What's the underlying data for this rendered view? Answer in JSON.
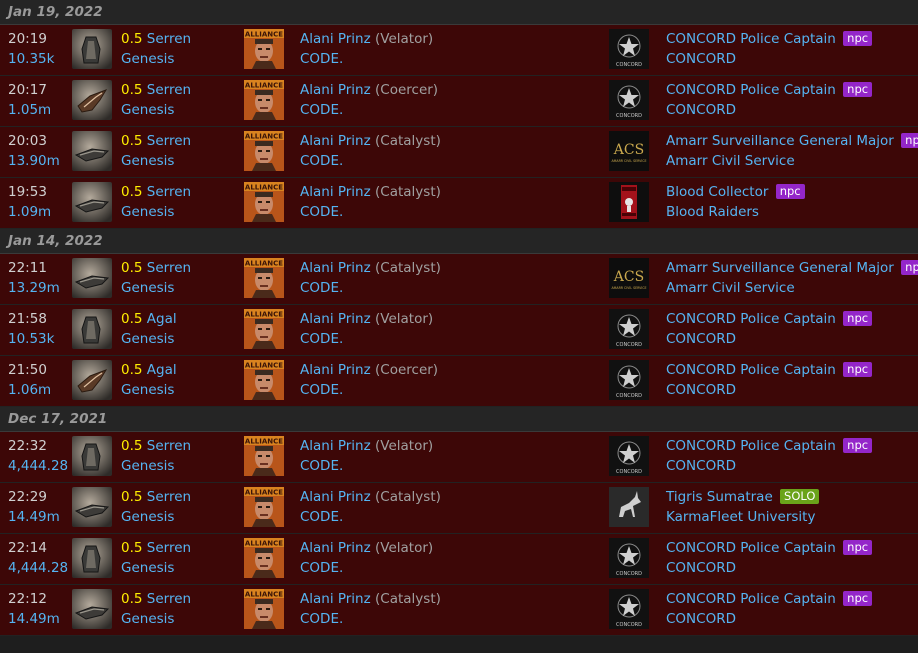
{
  "groups": [
    {
      "date": "Jan 19, 2022",
      "kills": [
        {
          "time": "20:19",
          "value": "10.35k",
          "ship_icon": "velator-icon",
          "sec": "0.5",
          "system": "Serren",
          "region": "Genesis",
          "pilot": "Alani Prinz",
          "ship": "(Velator)",
          "corp": "CODE.",
          "attacker_icon": "concord-logo",
          "attacker": "CONCORD Police Captain",
          "attacker_corp": "CONCORD",
          "badge": "npc"
        },
        {
          "time": "20:17",
          "value": "1.05m",
          "ship_icon": "coercer-icon",
          "sec": "0.5",
          "system": "Serren",
          "region": "Genesis",
          "pilot": "Alani Prinz",
          "ship": "(Coercer)",
          "corp": "CODE.",
          "attacker_icon": "concord-logo",
          "attacker": "CONCORD Police Captain",
          "attacker_corp": "CONCORD",
          "badge": "npc"
        },
        {
          "time": "20:03",
          "value": "13.90m",
          "ship_icon": "catalyst-icon",
          "sec": "0.5",
          "system": "Serren",
          "region": "Genesis",
          "pilot": "Alani Prinz",
          "ship": "(Catalyst)",
          "corp": "CODE.",
          "attacker_icon": "amarr-civil-service-logo",
          "attacker": "Amarr Surveillance General Major",
          "attacker_corp": "Amarr Civil Service",
          "badge": "npc"
        },
        {
          "time": "19:53",
          "value": "1.09m",
          "ship_icon": "catalyst-icon",
          "sec": "0.5",
          "system": "Serren",
          "region": "Genesis",
          "pilot": "Alani Prinz",
          "ship": "(Catalyst)",
          "corp": "CODE.",
          "attacker_icon": "blood-raiders-logo",
          "attacker": "Blood Collector",
          "attacker_corp": "Blood Raiders",
          "badge": "npc"
        }
      ]
    },
    {
      "date": "Jan 14, 2022",
      "kills": [
        {
          "time": "22:11",
          "value": "13.29m",
          "ship_icon": "catalyst-icon",
          "sec": "0.5",
          "system": "Serren",
          "region": "Genesis",
          "pilot": "Alani Prinz",
          "ship": "(Catalyst)",
          "corp": "CODE.",
          "attacker_icon": "amarr-civil-service-logo",
          "attacker": "Amarr Surveillance General Major",
          "attacker_corp": "Amarr Civil Service",
          "badge": "npc"
        },
        {
          "time": "21:58",
          "value": "10.53k",
          "ship_icon": "velator-icon",
          "sec": "0.5",
          "system": "Agal",
          "region": "Genesis",
          "pilot": "Alani Prinz",
          "ship": "(Velator)",
          "corp": "CODE.",
          "attacker_icon": "concord-logo",
          "attacker": "CONCORD Police Captain",
          "attacker_corp": "CONCORD",
          "badge": "npc"
        },
        {
          "time": "21:50",
          "value": "1.06m",
          "ship_icon": "coercer-icon",
          "sec": "0.5",
          "system": "Agal",
          "region": "Genesis",
          "pilot": "Alani Prinz",
          "ship": "(Coercer)",
          "corp": "CODE.",
          "attacker_icon": "concord-logo",
          "attacker": "CONCORD Police Captain",
          "attacker_corp": "CONCORD",
          "badge": "npc"
        }
      ]
    },
    {
      "date": "Dec 17, 2021",
      "kills": [
        {
          "time": "22:32",
          "value": "4,444.28",
          "ship_icon": "velator-icon",
          "sec": "0.5",
          "system": "Serren",
          "region": "Genesis",
          "pilot": "Alani Prinz",
          "ship": "(Velator)",
          "corp": "CODE.",
          "attacker_icon": "concord-logo",
          "attacker": "CONCORD Police Captain",
          "attacker_corp": "CONCORD",
          "badge": "npc"
        },
        {
          "time": "22:29",
          "value": "14.49m",
          "ship_icon": "catalyst-icon",
          "sec": "0.5",
          "system": "Serren",
          "region": "Genesis",
          "pilot": "Alani Prinz",
          "ship": "(Catalyst)",
          "corp": "CODE.",
          "attacker_icon": "unicorn-portrait",
          "attacker": "Tigris Sumatrae",
          "attacker_corp": "KarmaFleet University",
          "badge": "SOLO"
        },
        {
          "time": "22:14",
          "value": "4,444.28",
          "ship_icon": "velator-icon",
          "sec": "0.5",
          "system": "Serren",
          "region": "Genesis",
          "pilot": "Alani Prinz",
          "ship": "(Velator)",
          "corp": "CODE.",
          "attacker_icon": "concord-logo",
          "attacker": "CONCORD Police Captain",
          "attacker_corp": "CONCORD",
          "badge": "npc"
        },
        {
          "time": "22:12",
          "value": "14.49m",
          "ship_icon": "catalyst-icon",
          "sec": "0.5",
          "system": "Serren",
          "region": "Genesis",
          "pilot": "Alani Prinz",
          "ship": "(Catalyst)",
          "corp": "CODE.",
          "attacker_icon": "concord-logo",
          "attacker": "CONCORD Police Captain",
          "attacker_corp": "CONCORD",
          "badge": "npc"
        }
      ]
    }
  ],
  "icon_text": {
    "code_banner": "ALLIANCE",
    "acs_logo": "ACS",
    "acs_sub": "AMARR CIVIL SERVICE",
    "concord_sub": "CONCORD"
  },
  "colors": {
    "row_bg": "#3d0707",
    "link": "#55b4f2",
    "security": "#ffee00",
    "npc_badge": "#9426c9",
    "solo_badge": "#6aa31a"
  }
}
